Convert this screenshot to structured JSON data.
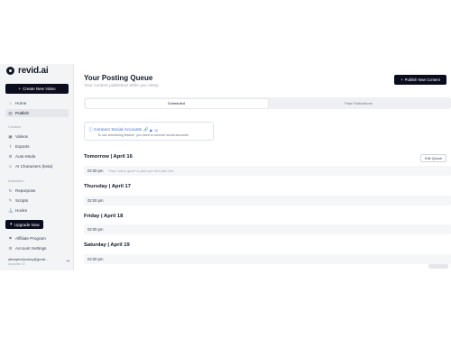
{
  "brand": {
    "name": "revid.ai"
  },
  "sidebar": {
    "create_label": "Create New Video",
    "top_items": [
      {
        "label": "Home",
        "icon": "home-icon",
        "glyph": "⌂"
      },
      {
        "label": "Publish",
        "icon": "publish-icon",
        "glyph": "▤"
      }
    ],
    "creation_label": "Creation",
    "creation_items": [
      {
        "label": "Videos",
        "glyph": "▣"
      },
      {
        "label": "Exports",
        "glyph": "⇪"
      },
      {
        "label": "Auto-Mode",
        "glyph": "⚙"
      },
      {
        "label": "AI Characters (beta)",
        "glyph": "☺"
      }
    ],
    "inspiration_label": "Inspiration",
    "inspiration_items": [
      {
        "label": "Repurpose",
        "glyph": "↻"
      },
      {
        "label": "Scripts",
        "glyph": "✎"
      },
      {
        "label": "Hooks",
        "glyph": "⚓"
      }
    ],
    "upgrade_label": "Upgrade Now",
    "bottom_items": [
      {
        "label": "Affiliate Program",
        "glyph": "⚑"
      },
      {
        "label": "Account Settings",
        "glyph": "⚙"
      }
    ],
    "account": {
      "email": "abhaytechjockey@gmail...",
      "sub": "Accounts: 10"
    }
  },
  "main": {
    "title": "Your Posting Queue",
    "subtitle": "Your content published while you sleep",
    "publish_label": "Publish New Content",
    "tabs": [
      {
        "label": "Scheduled",
        "active": true
      },
      {
        "label": "Past Publications",
        "active": false
      }
    ],
    "connect": {
      "title": "Connect Social Accounts",
      "desc": "To use scheduling feature, you need to connect social accounts"
    },
    "edit_queue_label": "Edit Queue",
    "days": [
      {
        "heading": "Tomorrow | April 16",
        "time": "02:00 pm",
        "note": "Press \"Add to queue\" to place your next video here"
      },
      {
        "heading": "Thursday | April 17",
        "time": "02:00 pm",
        "note": ""
      },
      {
        "heading": "Friday | April 18",
        "time": "02:00 pm",
        "note": ""
      },
      {
        "heading": "Saturday | April 19",
        "time": "02:00 pm",
        "note": ""
      }
    ]
  },
  "colors": {
    "primary": "#0b0d1e",
    "link": "#3b6bd6",
    "sidebar_bg": "#f3f4f6"
  }
}
